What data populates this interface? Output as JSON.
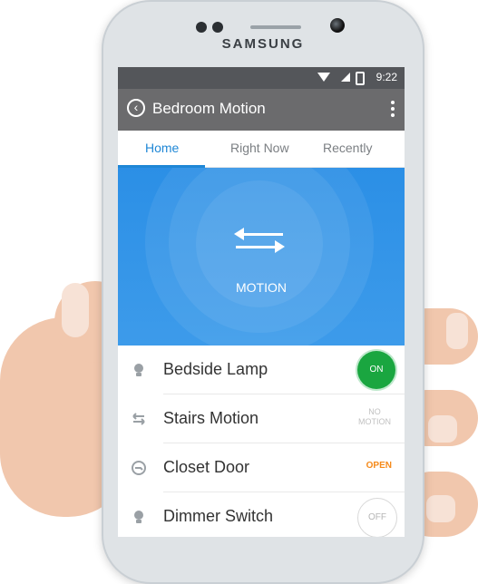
{
  "device": {
    "brand": "SAMSUNG"
  },
  "status_bar": {
    "time": "9:22"
  },
  "app_bar": {
    "title": "Bedroom Motion"
  },
  "tabs": [
    {
      "label": "Home",
      "active": true
    },
    {
      "label": "Right Now",
      "active": false
    },
    {
      "label": "Recently",
      "active": false
    }
  ],
  "hero": {
    "label": "MOTION"
  },
  "devices": [
    {
      "label": "Bedside Lamp",
      "state": "ON"
    },
    {
      "label": "Stairs Motion",
      "state": "NO MOTION"
    },
    {
      "label": "Closet Door",
      "state": "OPEN"
    },
    {
      "label": "Dimmer Switch",
      "state": "OFF"
    }
  ],
  "colors": {
    "accent": "#1f87d6",
    "on_green": "#1aa640",
    "open_orange": "#f58a1a"
  }
}
